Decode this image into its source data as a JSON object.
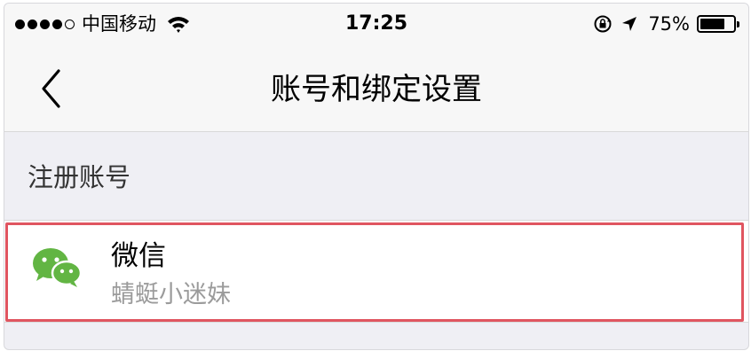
{
  "status_bar": {
    "carrier": "中国移动",
    "time": "17:25",
    "battery_percent_label": "75%",
    "battery_level": 0.75,
    "signal_bars_filled": 4,
    "signal_bars_total": 5,
    "icons": [
      "wifi-icon",
      "orientation-lock-icon",
      "location-arrow-icon",
      "battery-icon"
    ]
  },
  "nav": {
    "title": "账号和绑定设置",
    "back_icon": "chevron-left-icon"
  },
  "section": {
    "header": "注册账号",
    "accounts": [
      {
        "icon": "wechat-icon",
        "title": "微信",
        "subtitle": "蜻蜓小迷妹"
      }
    ]
  },
  "colors": {
    "background": "#efeff4",
    "bar": "#f7f7f7",
    "highlight": "#e05560",
    "wechat_green": "#62b543",
    "subtitle_gray": "#9b9b9b"
  }
}
